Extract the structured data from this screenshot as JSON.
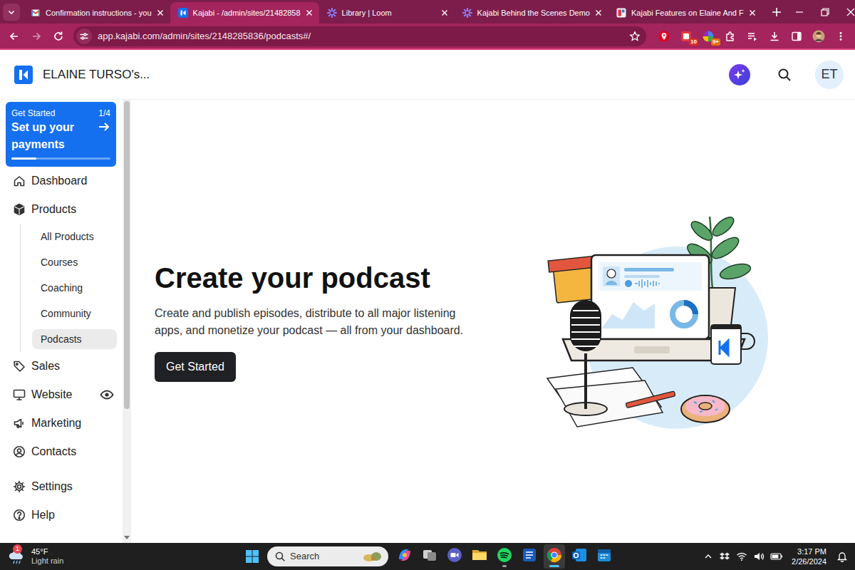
{
  "browser": {
    "tabs": [
      {
        "label": "Confirmation instructions - you",
        "selected": false,
        "kind": "gmail"
      },
      {
        "label": "Kajabi - /admin/sites/21482858",
        "selected": true,
        "kind": "kajabi"
      },
      {
        "label": "Library | Loom",
        "selected": false,
        "kind": "loom"
      },
      {
        "label": "Kajabi Behind the Scenes Demo",
        "selected": false,
        "kind": "loom"
      },
      {
        "label": "Kajabi Features on Elaine And F",
        "selected": false,
        "kind": "doc"
      }
    ],
    "address": "app.kajabi.com/admin/sites/2148285836/podcasts#/",
    "extension_badges": [
      "10",
      "9+"
    ]
  },
  "app": {
    "site_name": "ELAINE TURSO's...",
    "avatar": "ET"
  },
  "sidebar": {
    "setup": {
      "eyebrow": "Get Started",
      "step": "1/4",
      "title": "Set up your payments",
      "level": 0.25
    },
    "items": [
      {
        "label": "Dashboard",
        "selected": false
      },
      {
        "label": "Products",
        "selected": false,
        "children": [
          {
            "label": "All Products",
            "selected": false
          },
          {
            "label": "Courses",
            "selected": false
          },
          {
            "label": "Coaching",
            "selected": false
          },
          {
            "label": "Community",
            "selected": false
          },
          {
            "label": "Podcasts",
            "selected": true
          }
        ]
      },
      {
        "label": "Sales",
        "selected": false
      },
      {
        "label": "Website",
        "selected": false
      },
      {
        "label": "Marketing",
        "selected": false
      },
      {
        "label": "Contacts",
        "selected": false
      }
    ],
    "footer_items": [
      {
        "label": "Settings",
        "selected": false
      },
      {
        "label": "Help",
        "selected": false
      }
    ]
  },
  "main": {
    "title": "Create your podcast",
    "description": "Create and publish episodes, distribute to all major listening apps, and monetize your podcast — all from your dashboard.",
    "button": "Get Started"
  },
  "taskbar": {
    "weather": {
      "temperature": "45°F",
      "condition": "Light rain",
      "badge": "1"
    },
    "search": {
      "placeholder": "Search"
    },
    "apps": [
      {
        "kind": "copilot",
        "running": false,
        "selected": false
      },
      {
        "kind": "taskview",
        "running": false,
        "selected": false
      },
      {
        "kind": "chat",
        "running": false,
        "selected": false
      },
      {
        "kind": "explorer",
        "running": false,
        "selected": false
      },
      {
        "kind": "spotify",
        "running": true,
        "selected": false
      },
      {
        "kind": "word",
        "running": false,
        "selected": false
      },
      {
        "kind": "chrome",
        "running": true,
        "selected": true
      },
      {
        "kind": "outlook",
        "running": false,
        "selected": false
      },
      {
        "kind": "calendar",
        "running": false,
        "selected": false
      }
    ],
    "time": "3:17 PM",
    "date": "2/26/2024"
  }
}
